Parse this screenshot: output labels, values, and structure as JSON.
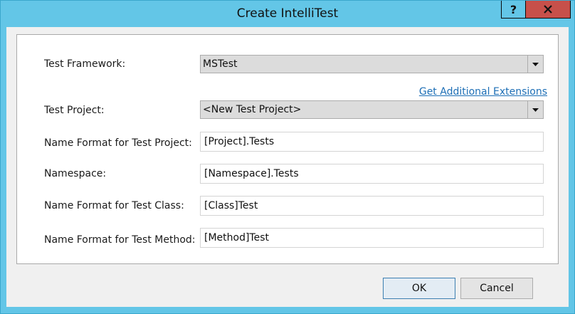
{
  "window": {
    "title": "Create IntelliTest",
    "help_label": "?"
  },
  "form": {
    "framework": {
      "label": "Test Framework:",
      "value": "MSTest"
    },
    "extensions_link": "Get Additional Extensions",
    "project": {
      "label": "Test Project:",
      "value": "<New Test Project>"
    },
    "project_name_format": {
      "label": "Name Format for Test Project:",
      "value": "[Project].Tests"
    },
    "namespace": {
      "label": "Namespace:",
      "value": "[Namespace].Tests"
    },
    "class_name_format": {
      "label": "Name Format for Test Class:",
      "value": "[Class]Test"
    },
    "method_name_format": {
      "label": "Name Format for Test Method:",
      "value": "[Method]Test"
    }
  },
  "buttons": {
    "ok": "OK",
    "cancel": "Cancel"
  },
  "colors": {
    "title_bar": "#63c6e7",
    "close_button": "#c7504a",
    "link": "#1e6fb6",
    "ok_border": "#3c7fb1"
  }
}
